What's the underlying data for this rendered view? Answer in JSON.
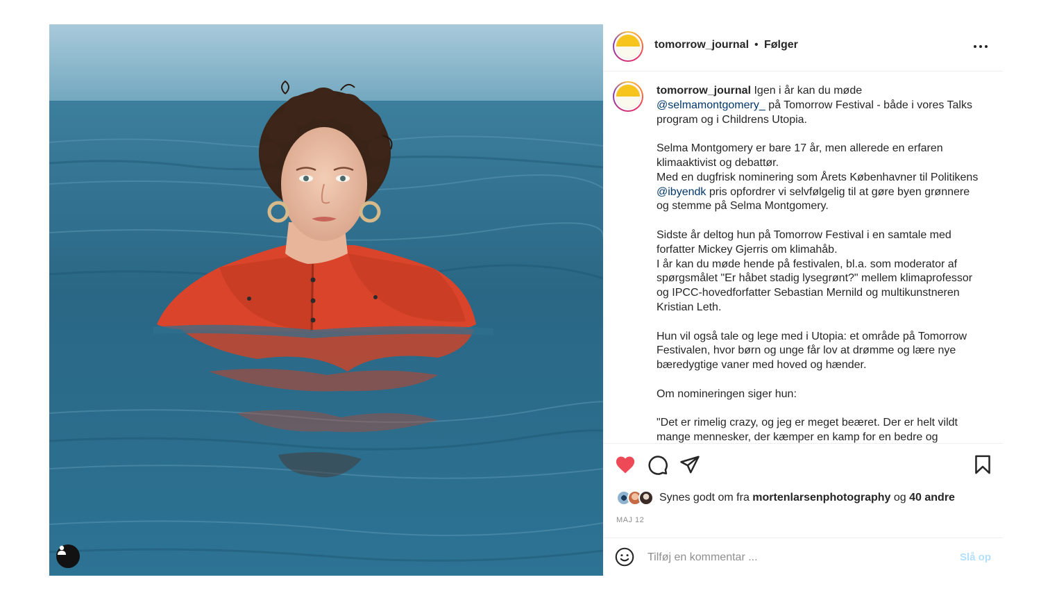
{
  "header": {
    "username": "tomorrow_journal",
    "separator": "•",
    "follow_label": "Følger",
    "more_icon": "more-dots-icon"
  },
  "caption": {
    "username": "tomorrow_journal",
    "intro_text": "Igen i år kan du møde",
    "mention_1": "@selmamontgomery_",
    "intro_text_2": "på Tomorrow Festival - både i vores Talks program og i Childrens Utopia.",
    "para2_line1": "Selma Montgomery er bare 17 år, men allerede en erfaren klimaaktivist og debattør.",
    "para2_line2a": "Med en dugfrisk nominering som Årets Københavner til Politikens",
    "mention_2": "@ibyendk",
    "para2_line2b": "pris opfordrer vi selvfølgelig til at gøre byen grønnere og stemme på Selma Montgomery.",
    "para3_line1": "Sidste år deltog hun på Tomorrow Festival i en samtale med forfatter Mickey Gjerris om klimahåb.",
    "para3_line2": "I år kan du møde hende på festivalen, bl.a. som moderator af spørgsmålet \"Er håbet stadig lysegrønt?\" mellem klimaprofessor og IPCC-hovedforfatter Sebastian Mernild og multikunstneren Kristian Leth.",
    "para4": "Hun vil også tale og lege med i Utopia: et område på Tomorrow Festivalen, hvor børn og unge får lov at drømme og lære nye bæredygtige vaner med hoved og hænder.",
    "para5": "Om nomineringen siger hun:",
    "para6": "\"Det er rimelig crazy, og jeg er meget beæret. Der er helt vildt mange mennesker, der kæmper en kamp for en bedre og"
  },
  "actions": {
    "like_icon": "heart-filled-icon",
    "comment_icon": "comment-icon",
    "share_icon": "share-paper-plane-icon",
    "save_icon": "bookmark-icon",
    "like_color": "#ed4956"
  },
  "likes": {
    "prefix": "Synes godt om fra",
    "user": "mortenlarsenphotography",
    "conjunction": "og",
    "others": "40 andre"
  },
  "date": "MAJ 12",
  "comment": {
    "placeholder": "Tilføj en kommentar ...",
    "post_label": "Slå op",
    "emoji_icon": "smiley-icon"
  },
  "photo": {
    "user_tag_icon": "user-tag-icon"
  }
}
